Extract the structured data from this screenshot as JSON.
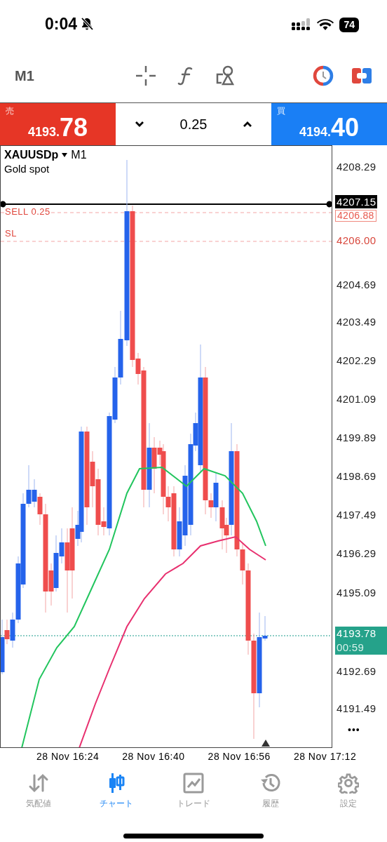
{
  "status_bar": {
    "time": "0:04",
    "battery": "74"
  },
  "toolbar": {
    "timeframe": "M1"
  },
  "trade_panel": {
    "sell": {
      "label": "売",
      "price_main": "4193.",
      "price_big": "78"
    },
    "volume": "0.25",
    "buy": {
      "label": "買",
      "price_main": "4194.",
      "price_big": "40"
    }
  },
  "chart": {
    "symbol": "XAUUSDp",
    "timeframe": "M1",
    "description": "Gold spot",
    "order_lines": [
      {
        "kind": "order",
        "label": "SELL 0.25"
      },
      {
        "kind": "sl",
        "label": "SL"
      }
    ],
    "price_labels": [
      {
        "kind": "plain",
        "text": "4208.29"
      },
      {
        "kind": "line",
        "text": "4207.15"
      },
      {
        "kind": "order",
        "text": "4206.88"
      },
      {
        "kind": "sl",
        "text": "4206.00"
      },
      {
        "kind": "plain",
        "text": "4204.69"
      },
      {
        "kind": "plain",
        "text": "4203.49"
      },
      {
        "kind": "plain",
        "text": "4202.29"
      },
      {
        "kind": "plain",
        "text": "4201.09"
      },
      {
        "kind": "plain",
        "text": "4199.89"
      },
      {
        "kind": "plain",
        "text": "4198.69"
      },
      {
        "kind": "plain",
        "text": "4197.49"
      },
      {
        "kind": "plain",
        "text": "4196.29"
      },
      {
        "kind": "plain",
        "text": "4195.09"
      },
      {
        "kind": "bid",
        "text": "4193.78",
        "timer": "00:59"
      },
      {
        "kind": "plain",
        "text": "4192.69"
      },
      {
        "kind": "plain",
        "text": "4191.49"
      }
    ],
    "more": "•••",
    "time_labels": [
      "28 Nov 16:24",
      "28 Nov 16:40",
      "28 Nov 16:56",
      "28 Nov 17:12"
    ]
  },
  "tabs": [
    {
      "kind": "quotes",
      "label": "気配値",
      "selected": false
    },
    {
      "kind": "chart",
      "label": "チャート",
      "selected": true
    },
    {
      "kind": "trade",
      "label": "トレード",
      "selected": false
    },
    {
      "kind": "history",
      "label": "履歴",
      "selected": false
    },
    {
      "kind": "settings",
      "label": "設定",
      "selected": false
    }
  ]
}
